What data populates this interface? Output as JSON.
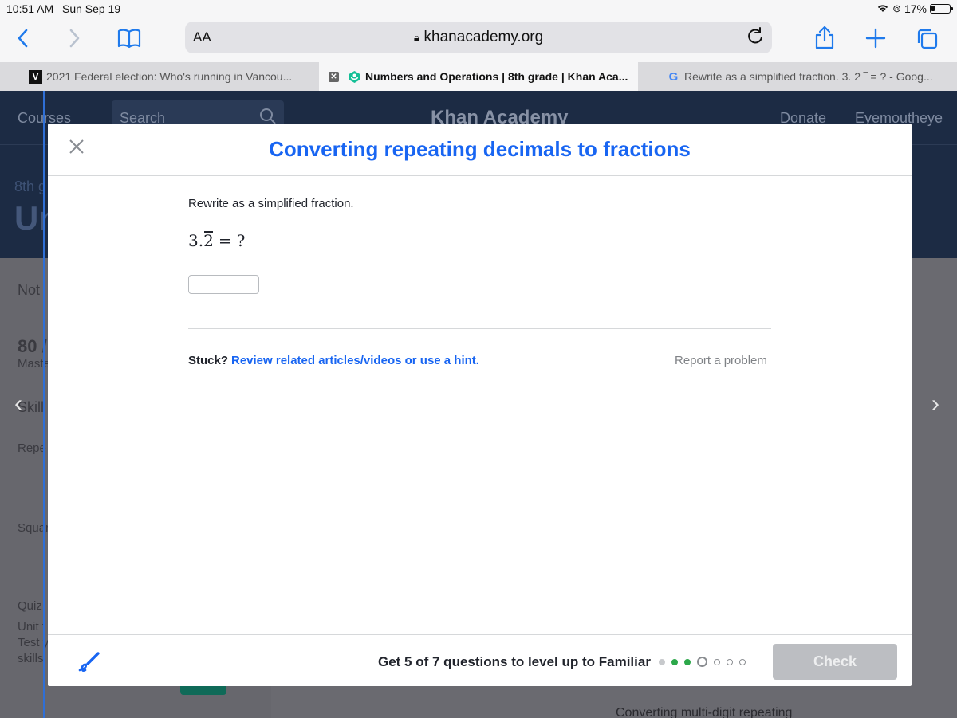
{
  "status_bar": {
    "time": "10:51 AM",
    "date": "Sun Sep 19",
    "battery": "17%"
  },
  "browser": {
    "text_size_label": "AA",
    "url": "khanacademy.org",
    "tabs": [
      {
        "label": "2021 Federal election: Who's running in Vancou...",
        "favicon": "V",
        "active": false
      },
      {
        "label": "Numbers and Operations | 8th grade | Khan Aca...",
        "favicon": "khan-icon",
        "active": true
      },
      {
        "label": "Rewrite as a simplified fraction. 3. 2 ‾ = ? - Goog...",
        "favicon": "G",
        "active": false
      }
    ]
  },
  "background_page": {
    "nav": {
      "courses": "Courses",
      "search_placeholder": "Search",
      "logo": "Khan Academy",
      "donate": "Donate",
      "user": "Eyemoutheye"
    },
    "grade_label": "8th g",
    "unit_label": "Un",
    "side_labels": [
      "Not",
      "80 /",
      "Maste",
      "Skill",
      "Repe",
      "Squar",
      "Quiz",
      "Unit t",
      "Test y",
      "skills"
    ],
    "footer_card": "Converting multi-digit repeating"
  },
  "modal": {
    "title": "Converting repeating decimals to fractions",
    "prompt": "Rewrite as a simplified fraction.",
    "equation": {
      "whole": "3.",
      "repeating_digit": "2",
      "equals": "=",
      "unknown": "?"
    },
    "answer_value": "",
    "stuck_label": "Stuck?",
    "hint_link": "Review related articles/videos or use a hint.",
    "report_link": "Report a problem",
    "level_up_text": "Get 5 of 7 questions to level up to Familiar",
    "progress": {
      "total": 7,
      "states": [
        "done",
        "correct",
        "correct",
        "current",
        "todo",
        "todo",
        "todo"
      ]
    },
    "check_label": "Check"
  },
  "colors": {
    "accent": "#1865f2",
    "correct": "#2ca84a",
    "header_bg": "#1c2b44"
  }
}
